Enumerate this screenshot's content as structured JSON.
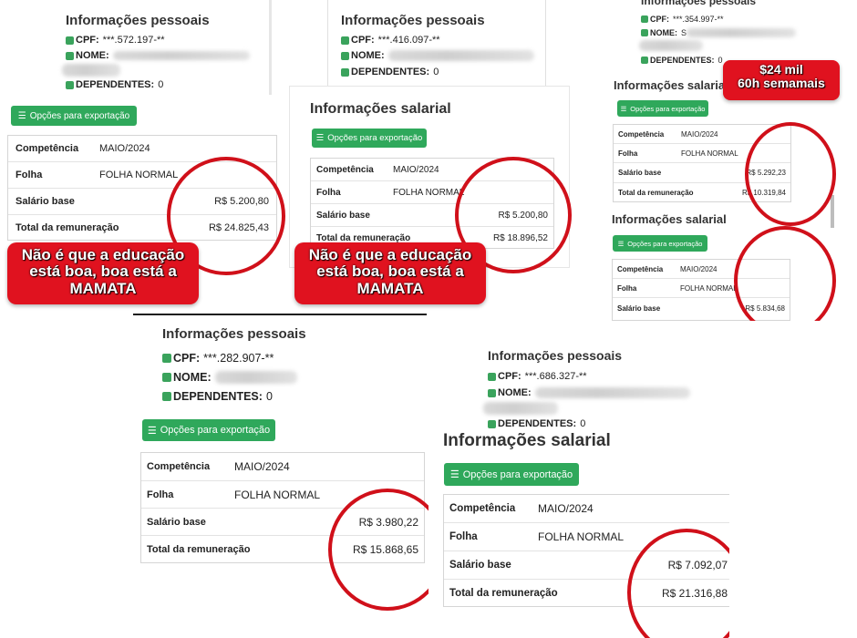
{
  "colors": {
    "accent_green": "#2fa85b",
    "highlight_red": "#d0101a",
    "caption_red": "#e0121f"
  },
  "labels": {
    "info_personal": "Informações pessoais",
    "info_salary": "Informações salarial",
    "cpf": "CPF:",
    "nome": "NOME:",
    "dependentes": "DEPENDENTES:",
    "export_button": "Opções para exportação",
    "competencia": "Competência",
    "folha": "Folha",
    "salario_base": "Salário base",
    "total": "Total da remuneração",
    "total_truncated": "Total da remuneração"
  },
  "icons": {
    "bullet": "green-square-icon",
    "menu": "menu-icon"
  },
  "caption_text": "Não é que a educação está boa, boa está a MAMATA",
  "panels": [
    {
      "cpf": "***.572.197-**",
      "dependentes": "0",
      "competencia": "MAIO/2024",
      "folha": "FOLHA NORMAL",
      "salario_base": "R$ 5.200,80",
      "total": "R$ 24.825,43"
    },
    {
      "cpf": "***.416.097-**",
      "dependentes": "0",
      "competencia": "MAIO/2024",
      "folha": "FOLHA NORMAL",
      "salario_base": "R$ 5.200,80",
      "total": "R$ 18.896,52"
    },
    {
      "cpf": "***.354.997-**",
      "nome_visible": "S",
      "dependentes": "0",
      "competencia": "MAIO/2024",
      "folha": "FOLHA NORMAL",
      "salario_base": "R$ 5.292,23",
      "total": "R$ 10.319,84",
      "second": {
        "competencia": "MAIO/2024",
        "folha": "FOLHA NORMAL",
        "salario_base": "R$ 5.834,68"
      },
      "badge_line1": "$24 mil",
      "badge_line2": "60h semamais"
    },
    {
      "cpf": "***.282.907-**",
      "dependentes": "0",
      "competencia": "MAIO/2024",
      "folha": "FOLHA NORMAL",
      "salario_base": "R$ 3.980,22",
      "total": "R$ 15.868,65"
    },
    {
      "cpf": "***.686.327-**",
      "dependentes": "0",
      "competencia": "MAIO/2024",
      "folha": "FOLHA NORMAL",
      "salario_base": "R$ 7.092,07",
      "total": "R$ 21.316,88"
    }
  ]
}
